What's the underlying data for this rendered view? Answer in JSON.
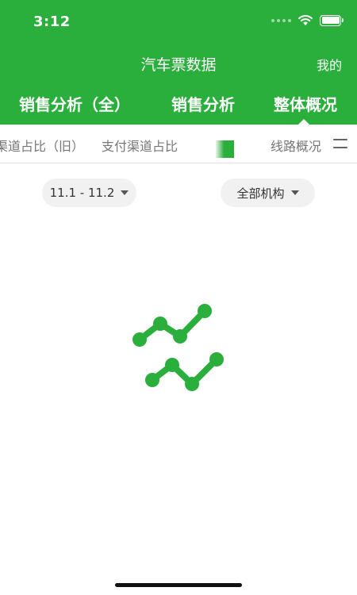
{
  "status_bar": {
    "time": "3:12",
    "icons": [
      "signal-icon",
      "wifi-icon",
      "battery-icon"
    ]
  },
  "header": {
    "title": "汽车票数据",
    "mine_label": "我的"
  },
  "main_tabs": [
    {
      "label": "销售分析（全）",
      "active": false
    },
    {
      "label": "销售分析",
      "active": false
    },
    {
      "label": "整体概况",
      "active": true
    }
  ],
  "sub_tabs": [
    {
      "label": "渠道占比（旧）",
      "active": false
    },
    {
      "label": "支付渠道占比",
      "active": false
    },
    {
      "label": "",
      "active": true
    },
    {
      "label": "线路概况",
      "active": false
    }
  ],
  "filters": {
    "date_range": "11.1 - 11.2",
    "organization": "全部机构"
  },
  "colors": {
    "accent": "#2aae3c",
    "filter_bg": "#f1f1f1"
  },
  "loading_icon": "line-chart-loading-icon"
}
